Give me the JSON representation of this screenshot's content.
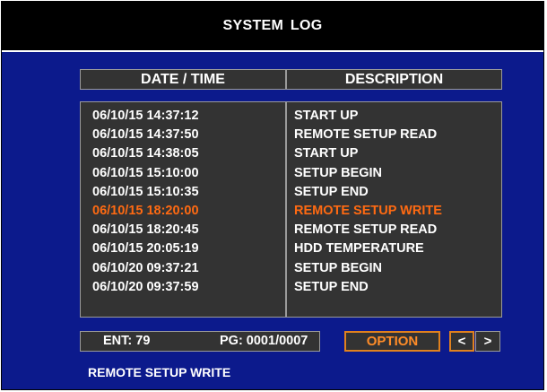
{
  "title": "SYSTEM  LOG",
  "columns": {
    "date_time": "DATE / TIME",
    "description": "DESCRIPTION"
  },
  "rows": [
    {
      "datetime": "06/10/15 14:37:12",
      "description": "START UP",
      "selected": false
    },
    {
      "datetime": "06/10/15 14:37:50",
      "description": "REMOTE SETUP READ",
      "selected": false
    },
    {
      "datetime": "06/10/15 14:38:05",
      "description": "START UP",
      "selected": false
    },
    {
      "datetime": "06/10/15 15:10:00",
      "description": "SETUP BEGIN",
      "selected": false
    },
    {
      "datetime": "06/10/15 15:10:35",
      "description": "SETUP END",
      "selected": false
    },
    {
      "datetime": "06/10/15 18:20:00",
      "description": "REMOTE SETUP WRITE",
      "selected": true
    },
    {
      "datetime": "06/10/15 18:20:45",
      "description": "REMOTE SETUP READ",
      "selected": false
    },
    {
      "datetime": "06/10/15 20:05:19",
      "description": "HDD TEMPERATURE",
      "selected": false
    },
    {
      "datetime": "06/10/20 09:37:21",
      "description": "SETUP BEGIN",
      "selected": false
    },
    {
      "datetime": "06/10/20 09:37:59",
      "description": "SETUP END",
      "selected": false
    }
  ],
  "footer": {
    "entries": "ENT: 79",
    "page": "PG: 0001/0007",
    "option_label": "OPTION",
    "prev_label": "<",
    "next_label": ">"
  },
  "status_message": "REMOTE SETUP WRITE",
  "colors": {
    "background": "#0c1a8c",
    "panel": "#333333",
    "highlight": "#ff6a12",
    "focus_border": "#e0811e"
  }
}
